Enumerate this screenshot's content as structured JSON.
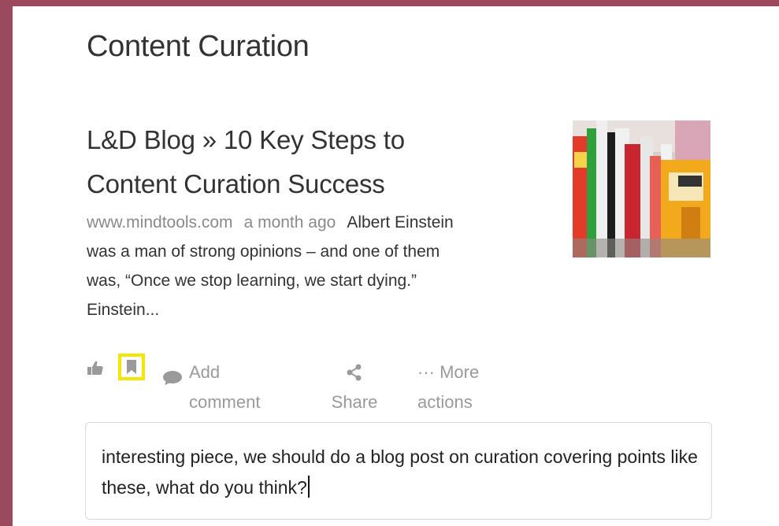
{
  "section": {
    "title": "Content Curation"
  },
  "article": {
    "title_line1": "L&D Blog » 10 Key Steps to",
    "title_line2": "Content Curation Success",
    "source": "www.mindtools.com",
    "time": "a month ago",
    "excerpt_line1": "Albert Einstein",
    "excerpt_line2": "was a man of strong opinions – and one of them",
    "excerpt_line3": "was, “Once we stop learning, we start dying.”",
    "excerpt_line4": "Einstein..."
  },
  "actions": {
    "comment_line1": "Add",
    "comment_line2": "comment",
    "share_label": "Share",
    "more_line1": "··· More",
    "more_line2": "actions"
  },
  "comment_field": {
    "value": "interesting piece, we should do a blog post on curation covering points like these, what do you think?"
  },
  "colors": {
    "frame": "#9b4a5d",
    "highlight": "#f4e600",
    "muted": "#9a9a9a"
  },
  "icons": [
    "thumbs-up-icon",
    "bookmark-icon",
    "comment-bubble-icon",
    "share-icon"
  ]
}
